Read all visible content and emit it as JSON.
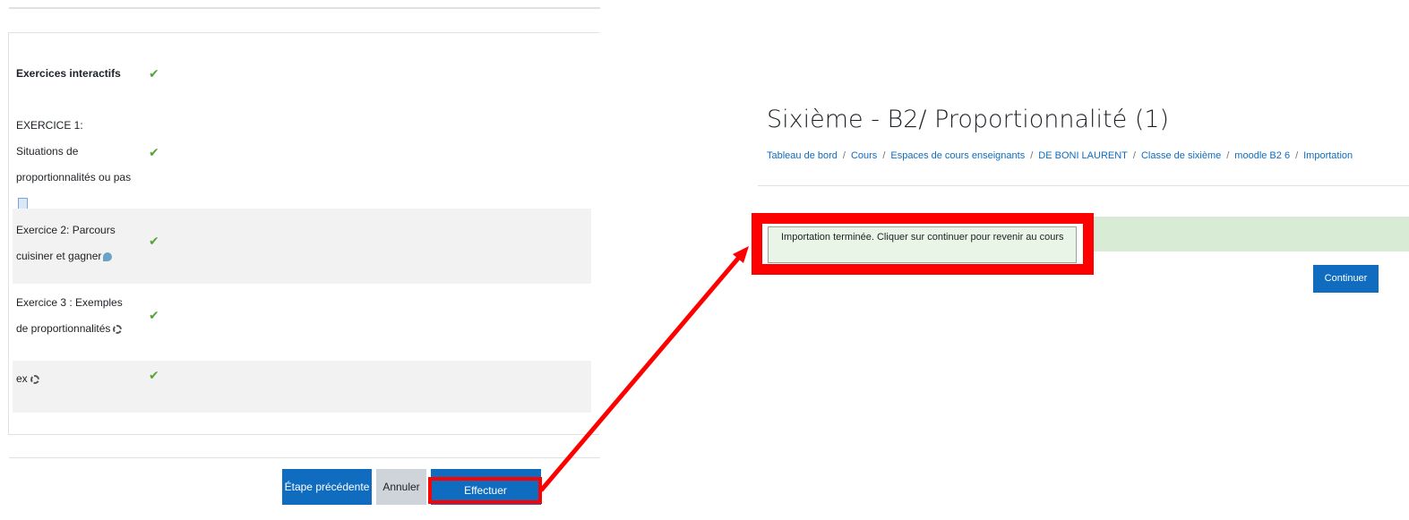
{
  "left": {
    "activities": [
      {
        "name": "Exercices interactifs",
        "checked": true,
        "icon": null
      },
      {
        "name": "EXERCICE 1: Situations de proportionnalités ou pas",
        "checked": true,
        "icon": "file-icon"
      },
      {
        "name": "Exercice 2: Parcours cuisiner et gagner",
        "checked": true,
        "icon": "droplet-icon"
      },
      {
        "name": "Exercice 3 : Exemples de proportionnalités",
        "checked": true,
        "icon": "module-icon"
      },
      {
        "name": "ex",
        "checked": true,
        "icon": "module-icon"
      }
    ],
    "check_glyph": "✔",
    "buttons": {
      "previous": "Étape précédente",
      "cancel": "Annuler",
      "import": "Effectuer l'importation"
    }
  },
  "right": {
    "title": "Sixième - B2/ Proportionnalité (1)",
    "breadcrumb": [
      "Tableau de bord",
      "Cours",
      "Espaces de cours enseignants",
      "DE BONI LAURENT",
      "Classe de sixième",
      "moodle B2 6",
      "Importation"
    ],
    "alert_text": "Importation terminée. Cliquer sur continuer pour revenir au cours",
    "continue_label": "Continuer"
  },
  "colors": {
    "primary": "#0f6cbf",
    "success_bg": "#d7ebd5",
    "check": "#5aa23a",
    "highlight": "#ff0000"
  }
}
